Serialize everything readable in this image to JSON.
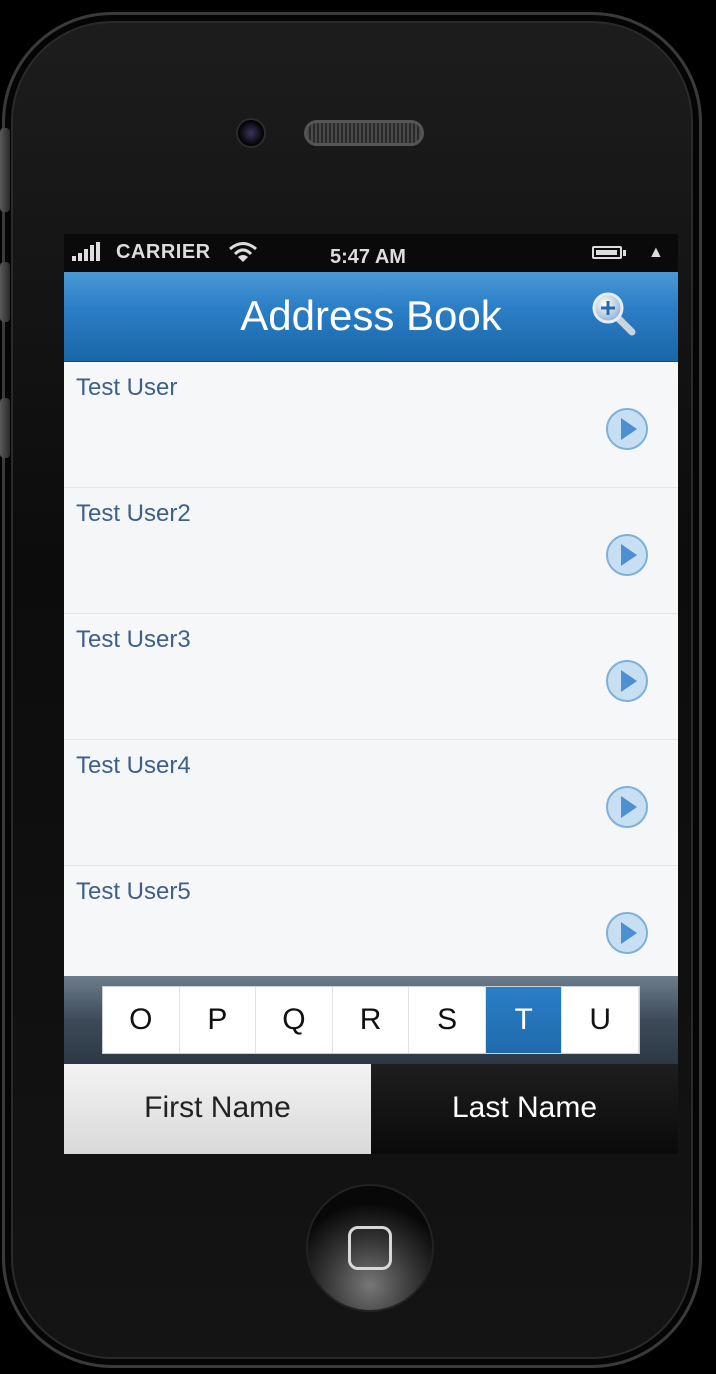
{
  "statusbar": {
    "carrier": "CARRIER",
    "time": "5:47 AM"
  },
  "header": {
    "title": "Address Book",
    "search_icon": "zoom-in-icon"
  },
  "contacts": [
    {
      "name": "Test User",
      "icon": "arrow-right-circle-icon"
    },
    {
      "name": "Test User2",
      "icon": "arrow-right-circle-icon"
    },
    {
      "name": "Test User3",
      "icon": "arrow-right-circle-icon"
    },
    {
      "name": "Test User4",
      "icon": "arrow-right-circle-icon"
    },
    {
      "name": "Test User5",
      "icon": "arrow-right-circle-icon"
    }
  ],
  "alphabet": {
    "letters": [
      "O",
      "P",
      "Q",
      "R",
      "S",
      "T",
      "U"
    ],
    "selected": "T"
  },
  "tabs": {
    "first_name": "First Name",
    "last_name": "Last Name",
    "active": "first_name"
  },
  "colors": {
    "header": "#2b7ec6",
    "accent": "#1f6aab",
    "contact_text": "#3e5f88"
  }
}
